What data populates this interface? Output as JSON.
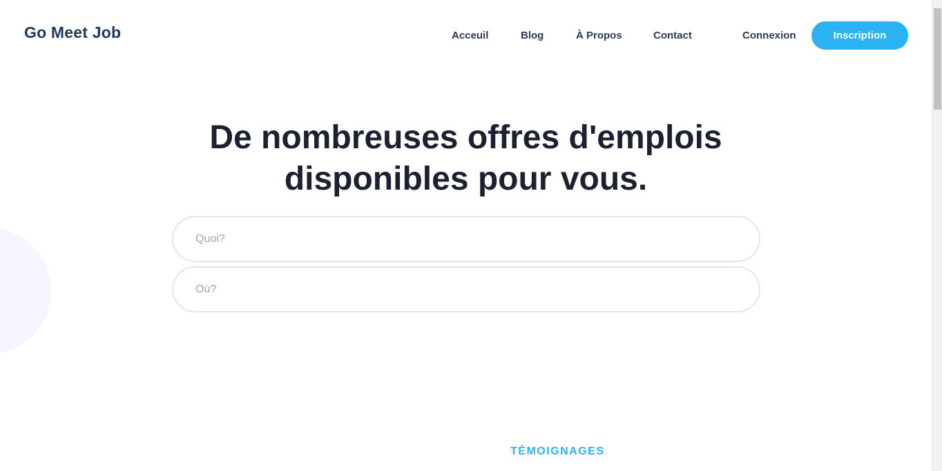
{
  "header": {
    "logo": "Go Meet Job",
    "nav": {
      "acceuil": "Acceuil",
      "blog": "Blog",
      "apropos": "À Propos",
      "contact": "Contact",
      "connexion": "Connexion"
    },
    "signup_label": "Inscription",
    "accent_color": "#2bb2f2"
  },
  "hero": {
    "title_line1": "De nombreuses offres d'emplois",
    "title_line2": "disponibles pour vous."
  },
  "search": {
    "what_placeholder": "Quoi?",
    "where_placeholder": "Où?"
  },
  "testimonials": {
    "label": "TÉMOIGNAGES"
  }
}
